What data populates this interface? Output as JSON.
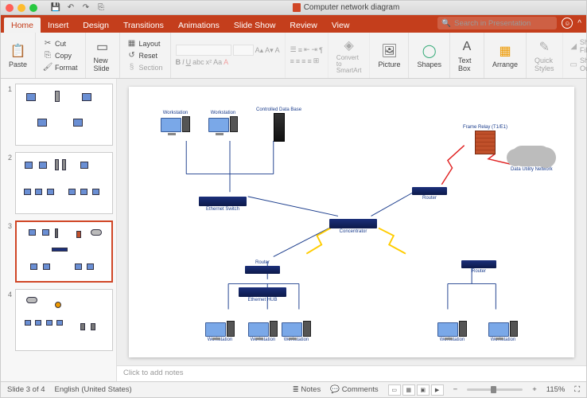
{
  "titlebar": {
    "doc_name": "Computer network diagram"
  },
  "tabs": {
    "home": "Home",
    "insert": "Insert",
    "design": "Design",
    "transitions": "Transitions",
    "animations": "Animations",
    "slideshow": "Slide Show",
    "review": "Review",
    "view": "View",
    "search_placeholder": "Search in Presentation"
  },
  "ribbon": {
    "paste": "Paste",
    "cut": "Cut",
    "copy": "Copy",
    "format": "Format",
    "new_slide": "New Slide",
    "layout": "Layout",
    "reset": "Reset",
    "section": "Section",
    "convert": "Convert to SmartArt",
    "picture": "Picture",
    "shapes": "Shapes",
    "textbox": "Text Box",
    "arrange": "Arrange",
    "quick_styles": "Quick Styles",
    "shape_fill": "Shape Fill",
    "shape_outline": "Shape Outline"
  },
  "thumbs": {
    "n1": "1",
    "n2": "2",
    "n3": "3",
    "n4": "4"
  },
  "diagram": {
    "workstation": "Workstation",
    "controlled_db": "Controlled Data Base",
    "ethernet_switch": "Ethernet Switch",
    "router": "Router",
    "concentrator": "Concentrator",
    "frame_relay": "Frame Relay (T1/E1)",
    "data_utility": "Data Utility Network",
    "ethernet_hub": "Ethernet HUB"
  },
  "notes": {
    "placeholder": "Click to add notes"
  },
  "status": {
    "slide": "Slide 3 of 4",
    "lang": "English (United States)",
    "notes": "Notes",
    "comments": "Comments",
    "zoom": "115%"
  }
}
